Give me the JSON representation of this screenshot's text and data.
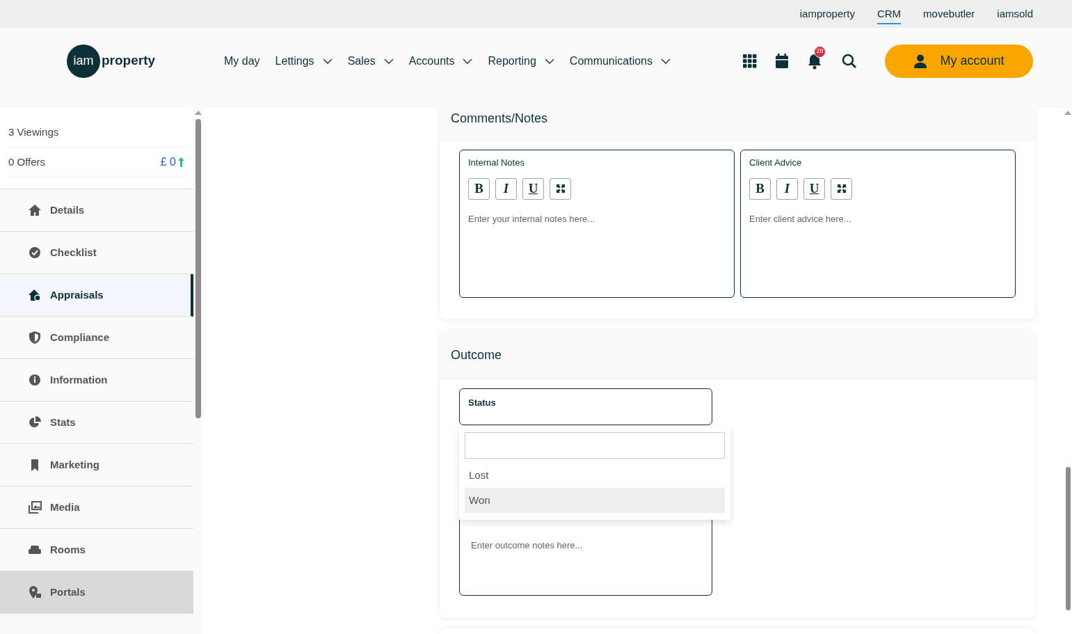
{
  "top_links": [
    {
      "label": "iamproperty",
      "selected": false
    },
    {
      "label": "CRM",
      "selected": true
    },
    {
      "label": "movebutler",
      "selected": false
    },
    {
      "label": "iamsold",
      "selected": false
    }
  ],
  "logo": {
    "mark": "iam",
    "word": "property"
  },
  "nav": [
    {
      "label": "My day",
      "dropdown": false
    },
    {
      "label": "Lettings",
      "dropdown": true
    },
    {
      "label": "Sales",
      "dropdown": true
    },
    {
      "label": "Accounts",
      "dropdown": true
    },
    {
      "label": "Reporting",
      "dropdown": true
    },
    {
      "label": "Communications",
      "dropdown": true
    }
  ],
  "notifications": {
    "badge": "28"
  },
  "account_button": "My account",
  "sidebar": {
    "stats": [
      {
        "label": "3 Viewings"
      },
      {
        "label": "0 Offers",
        "value": "£ 0"
      }
    ],
    "items": [
      {
        "label": "Details",
        "selected": false,
        "hovered": false
      },
      {
        "label": "Checklist",
        "selected": false,
        "hovered": false
      },
      {
        "label": "Appraisals",
        "selected": true,
        "hovered": false
      },
      {
        "label": "Compliance",
        "selected": false,
        "hovered": false
      },
      {
        "label": "Information",
        "selected": false,
        "hovered": false
      },
      {
        "label": "Stats",
        "selected": false,
        "hovered": false
      },
      {
        "label": "Marketing",
        "selected": false,
        "hovered": false
      },
      {
        "label": "Media",
        "selected": false,
        "hovered": false
      },
      {
        "label": "Rooms",
        "selected": false,
        "hovered": false
      },
      {
        "label": "Portals",
        "selected": false,
        "hovered": true
      }
    ]
  },
  "comments": {
    "title": "Comments/Notes",
    "editors": [
      {
        "label": "Internal Notes",
        "toolbar": [
          "B",
          "I",
          "U"
        ],
        "placeholder": "Enter your internal notes here..."
      },
      {
        "label": "Client Advice",
        "toolbar": [
          "B",
          "I",
          "U"
        ],
        "placeholder": "Enter client advice here..."
      }
    ]
  },
  "outcome": {
    "title": "Outcome",
    "status": {
      "label": "Status",
      "options": [
        {
          "label": "Lost",
          "selected": false
        },
        {
          "label": "Won",
          "selected": true
        }
      ]
    },
    "notes": {
      "placeholder": "Enter outcome notes here..."
    }
  }
}
